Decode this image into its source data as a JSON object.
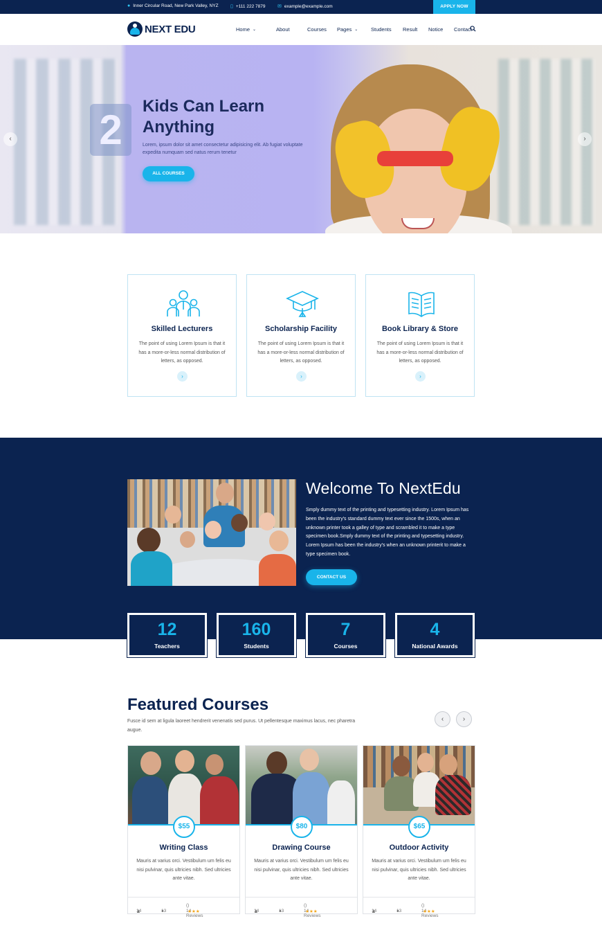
{
  "topbar": {
    "address": "Inner Circular Road, New Park Valley, NYZ",
    "phone": "+111 222 7879",
    "email": "example@example.com",
    "apply_label": "APPLY NOW"
  },
  "header": {
    "logo_text": "NEXT EDU",
    "nav": [
      "Home",
      "About",
      "Courses",
      "Pages",
      "Students",
      "Result",
      "Notice",
      "Contact"
    ]
  },
  "hero": {
    "title": "Kids Can Learn Anything",
    "subtitle": "Lorem, ipsum dolor sit amet consectetur adipisicing elit. Ab fugiat voluptate expedita numquam sed natus rerum tenetur",
    "button": "ALL COURSES",
    "image_number": "2"
  },
  "features": [
    {
      "title": "Skilled Lecturers",
      "text": "The point of using Lorem Ipsum is that it has a more-or-less normal distribution of letters, as opposed.",
      "icon": "lecturers-icon"
    },
    {
      "title": "Scholarship Facility",
      "text": "The point of using Lorem Ipsum is that it has a more-or-less normal distribution of letters, as opposed.",
      "icon": "graduation-cap-icon"
    },
    {
      "title": "Book Library & Store",
      "text": "The point of using Lorem Ipsum is that it has a more-or-less normal distribution of letters, as opposed.",
      "icon": "book-icon"
    }
  ],
  "welcome": {
    "title": "Welcome To NextEdu",
    "text": "Smply dummy text of the printing and typesetting industry. Lorem Ipsum has been the industry's standard dummy text ever since the 1500s, when an unknown printer took a galley of type and scrambled it to make a type specimen book.Smply dummy text of the printing and typesetting industry. Lorem Ipsum has been the industry's when an unknown printerit to make a type specimen book.",
    "button": "CONTACT US"
  },
  "stats": [
    {
      "value": "12",
      "label": "Teachers"
    },
    {
      "value": "160",
      "label": "Students"
    },
    {
      "value": "7",
      "label": "Courses"
    },
    {
      "value": "4",
      "label": "National Awards"
    }
  ],
  "featured": {
    "title": "Featured Courses",
    "subtitle": "Fusce id sem at ligula laoreet hendrerit venenatis sed purus. Ut pellentesque maximus lacus, nec pharetra augue.",
    "courses": [
      {
        "price": "$55",
        "title": "Writing Class",
        "text": "Mauris at varius orci. Vestibulum um felis eu nisi pulvinar, quis ultricies nibh. Sed ultricies ante vitae.",
        "students": "14",
        "comments": "13",
        "reviews": "14 Reviews"
      },
      {
        "price": "$80",
        "title": "Drawing Course",
        "text": "Mauris at varius orci. Vestibulum um felis eu nisi pulvinar, quis ultricies nibh. Sed ultricies ante vitae.",
        "students": "14",
        "comments": "13",
        "reviews": "14 Reviews"
      },
      {
        "price": "$65",
        "title": "Outdoor Activity",
        "text": "Mauris at varius orci. Vestibulum um felis eu nisi pulvinar, quis ultricies nibh. Sed ultricies ante vitae.",
        "students": "14",
        "comments": "13",
        "reviews": "14 Reviews"
      }
    ]
  },
  "colors": {
    "navy": "#0b2350",
    "accent": "#19b4ea",
    "star": "#f2a51a"
  }
}
